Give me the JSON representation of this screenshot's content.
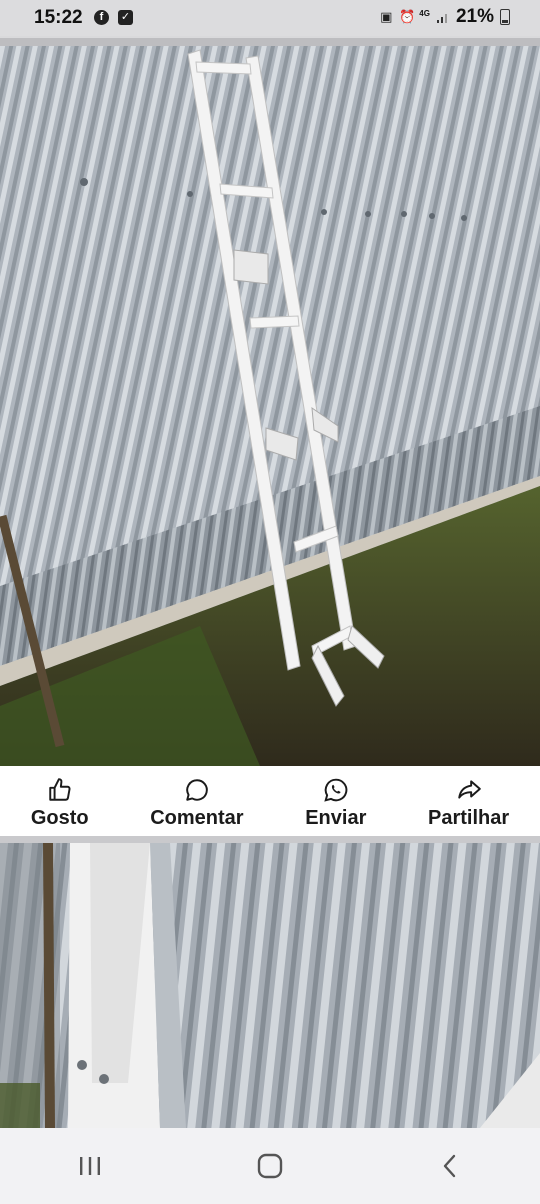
{
  "status_bar": {
    "time": "15:22",
    "left_icons": [
      "facebook-icon",
      "checkbox-notification-icon"
    ],
    "network_label": "4G",
    "battery_percent": "21%"
  },
  "post": {
    "actions": [
      {
        "label": "Gosto",
        "icon": "like-icon"
      },
      {
        "label": "Comentar",
        "icon": "comment-icon"
      },
      {
        "label": "Enviar",
        "icon": "whatsapp-icon"
      },
      {
        "label": "Partilhar",
        "icon": "share-icon"
      }
    ],
    "photos": [
      "ladder-against-corrugated-wall-photo",
      "ladder-closeup-photo"
    ]
  },
  "nav_bar": {
    "buttons": [
      "recent-apps-icon",
      "home-icon",
      "back-icon"
    ]
  },
  "colors": {
    "metal": "#a9b0b8",
    "grass": "#3d4a22",
    "ladder": "#f2f2f2",
    "action_bg": "#ffffff"
  }
}
